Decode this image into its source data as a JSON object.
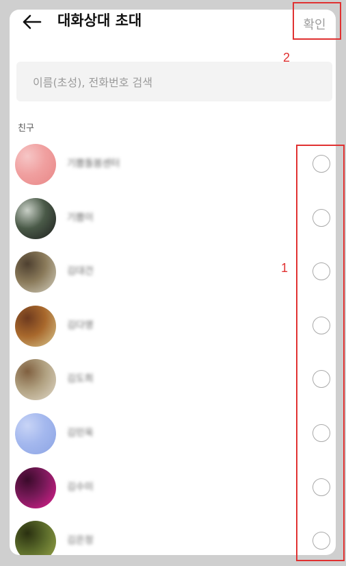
{
  "header": {
    "title": "대화상대 초대",
    "confirm_label": "확인"
  },
  "search": {
    "placeholder": "이름(초성), 전화번호 검색"
  },
  "section": {
    "label": "친구"
  },
  "annotations": {
    "radio_group_number": "1",
    "confirm_number": "2",
    "color": "#e03030"
  },
  "friends": [
    {
      "name": "기쁨돌봄센터",
      "avatar_colors": [
        "#f0a0a0",
        "#e88686",
        "#f6c6c6"
      ]
    },
    {
      "name": "기쁨이",
      "avatar_colors": [
        "#4a5a48",
        "#1d1d1d",
        "#c8cfc6"
      ]
    },
    {
      "name": "김대건",
      "avatar_colors": [
        "#8a7a5a",
        "#d4d0c0",
        "#4e4030"
      ]
    },
    {
      "name": "김다영",
      "avatar_colors": [
        "#a8682c",
        "#d8c890",
        "#6e3a1e"
      ]
    },
    {
      "name": "김도희",
      "avatar_colors": [
        "#b0a080",
        "#e0d8c8",
        "#806040"
      ]
    },
    {
      "name": "김민욱",
      "avatar_colors": [
        "#a4b8ee",
        "#8ca4e4",
        "#c8d4f6"
      ]
    },
    {
      "name": "김수미",
      "avatar_colors": [
        "#7a1a5a",
        "#e02090",
        "#3a0a2a"
      ]
    },
    {
      "name": "김은정",
      "avatar_colors": [
        "#5a6a2a",
        "#9aa84a",
        "#2a3010"
      ]
    }
  ]
}
